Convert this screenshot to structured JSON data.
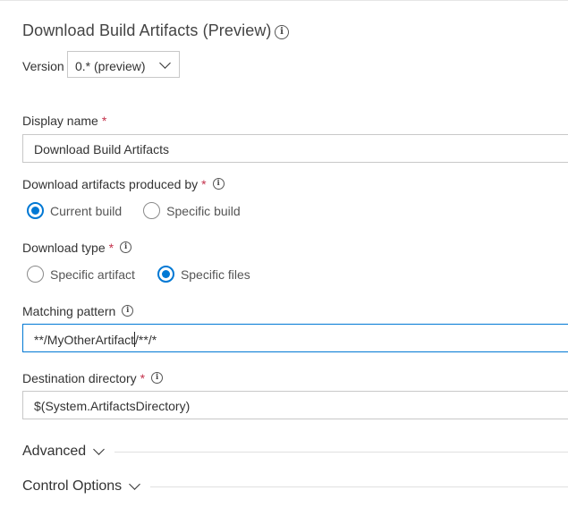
{
  "task": {
    "title": "Download Build Artifacts (Preview)",
    "version_label": "Version",
    "version_value": "0.* (preview)"
  },
  "fields": {
    "display_name": {
      "label": "Display name",
      "value": "Download Build Artifacts"
    },
    "produced_by": {
      "label": "Download artifacts produced by",
      "options": [
        "Current build",
        "Specific build"
      ],
      "selected": "Current build"
    },
    "download_type": {
      "label": "Download type",
      "options": [
        "Specific artifact",
        "Specific files"
      ],
      "selected": "Specific files"
    },
    "matching_pattern": {
      "label": "Matching pattern",
      "value_before_cursor": "**/MyOtherArtifact",
      "value_after_cursor": "/**/*"
    },
    "destination": {
      "label": "Destination directory",
      "value": "$(System.ArtifactsDirectory)"
    }
  },
  "sections": {
    "advanced": "Advanced",
    "control_options": "Control Options"
  },
  "icons": {
    "info": "info-icon",
    "dropdown": "chevron-down-icon"
  },
  "colors": {
    "accent": "#0078d4",
    "required": "#c4314b"
  },
  "required_mark": "*"
}
